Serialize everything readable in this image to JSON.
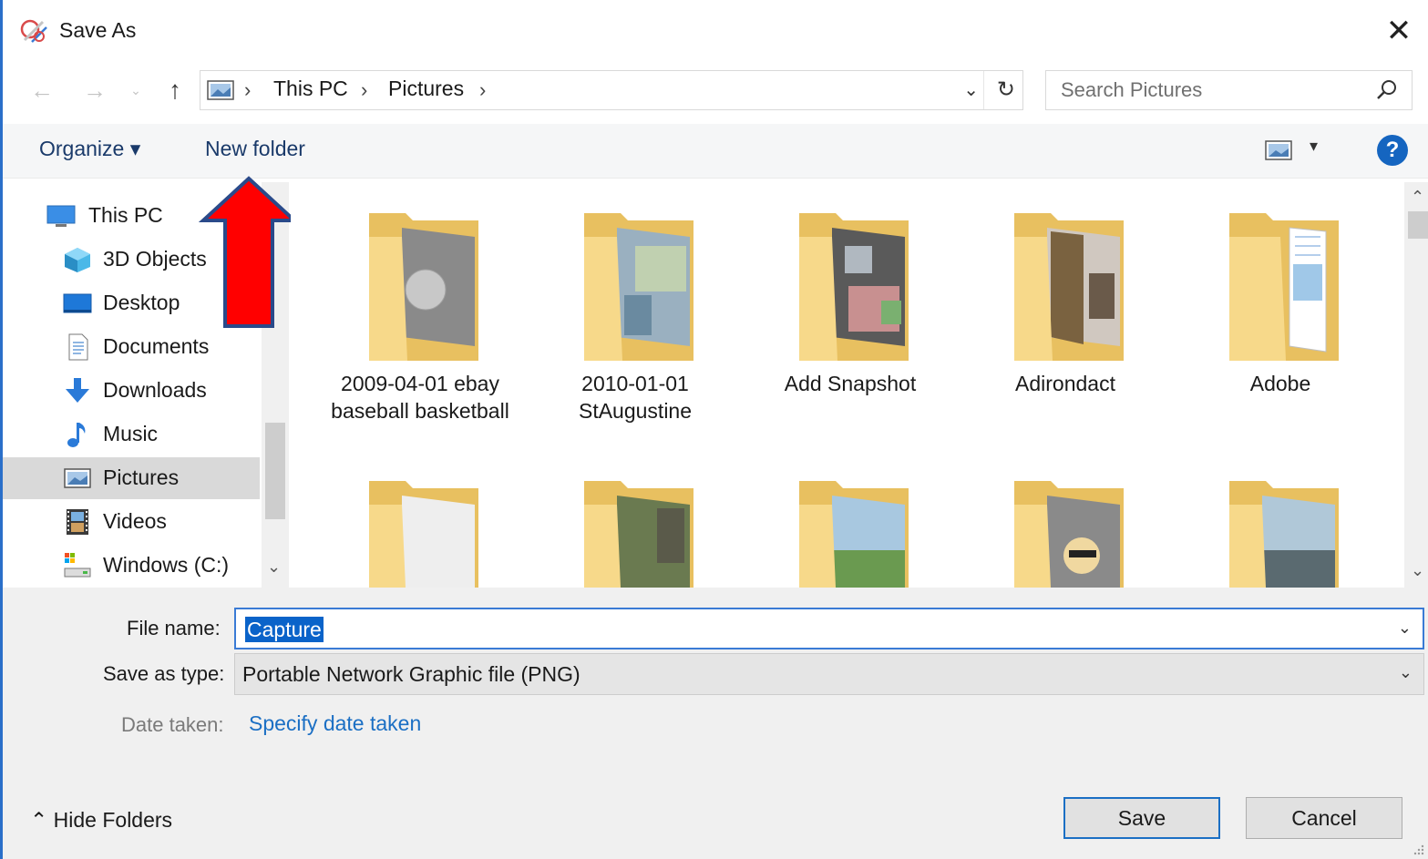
{
  "window": {
    "title": "Save As",
    "close_glyph": "✕"
  },
  "nav": {
    "back_glyph": "←",
    "forward_glyph": "→",
    "recent_glyph": "⌄",
    "up_glyph": "↑",
    "breadcrumbs": [
      "This PC",
      "Pictures"
    ],
    "crumb_sep": "›",
    "dropdown_glyph": "⌄",
    "refresh_glyph": "↻",
    "search_placeholder": "Search Pictures"
  },
  "toolbar": {
    "organize_label": "Organize ▾",
    "new_folder_label": "New folder",
    "view_dropdown_glyph": "▾",
    "help_glyph": "?"
  },
  "sidebar": {
    "items": [
      {
        "label": "This PC",
        "icon": "monitor-icon"
      },
      {
        "label": "3D Objects",
        "icon": "cube-icon"
      },
      {
        "label": "Desktop",
        "icon": "desktop-icon"
      },
      {
        "label": "Documents",
        "icon": "document-icon"
      },
      {
        "label": "Downloads",
        "icon": "download-icon"
      },
      {
        "label": "Music",
        "icon": "music-icon"
      },
      {
        "label": "Pictures",
        "icon": "pictures-icon"
      },
      {
        "label": "Videos",
        "icon": "film-icon"
      },
      {
        "label": "Windows (C:)",
        "icon": "drive-icon"
      }
    ],
    "selected": "Pictures",
    "scroll_down_glyph": "⌄"
  },
  "folders": [
    {
      "label": "2009-04-01 ebay baseball basketball"
    },
    {
      "label": "2010-01-01 StAugustine"
    },
    {
      "label": "Add Snapshot"
    },
    {
      "label": "Adirondact"
    },
    {
      "label": "Adobe"
    },
    {
      "label": ""
    },
    {
      "label": ""
    },
    {
      "label": ""
    },
    {
      "label": ""
    },
    {
      "label": ""
    }
  ],
  "content_scroll": {
    "up_glyph": "⌃",
    "down_glyph": "⌄"
  },
  "form": {
    "file_name_label": "File name:",
    "file_name_value": "Capture",
    "save_as_type_label": "Save as type:",
    "save_as_type_value": "Portable Network Graphic file (PNG)",
    "date_taken_label": "Date taken:",
    "date_taken_link": "Specify date taken",
    "dropdown_glyph": "⌄"
  },
  "footer": {
    "hide_folders_label": "⌃  Hide Folders",
    "save_label": "Save",
    "cancel_label": "Cancel"
  },
  "colors": {
    "accent": "#1b6fc4",
    "selection": "#0a63c9",
    "annotation_arrow": "#ff0000"
  }
}
